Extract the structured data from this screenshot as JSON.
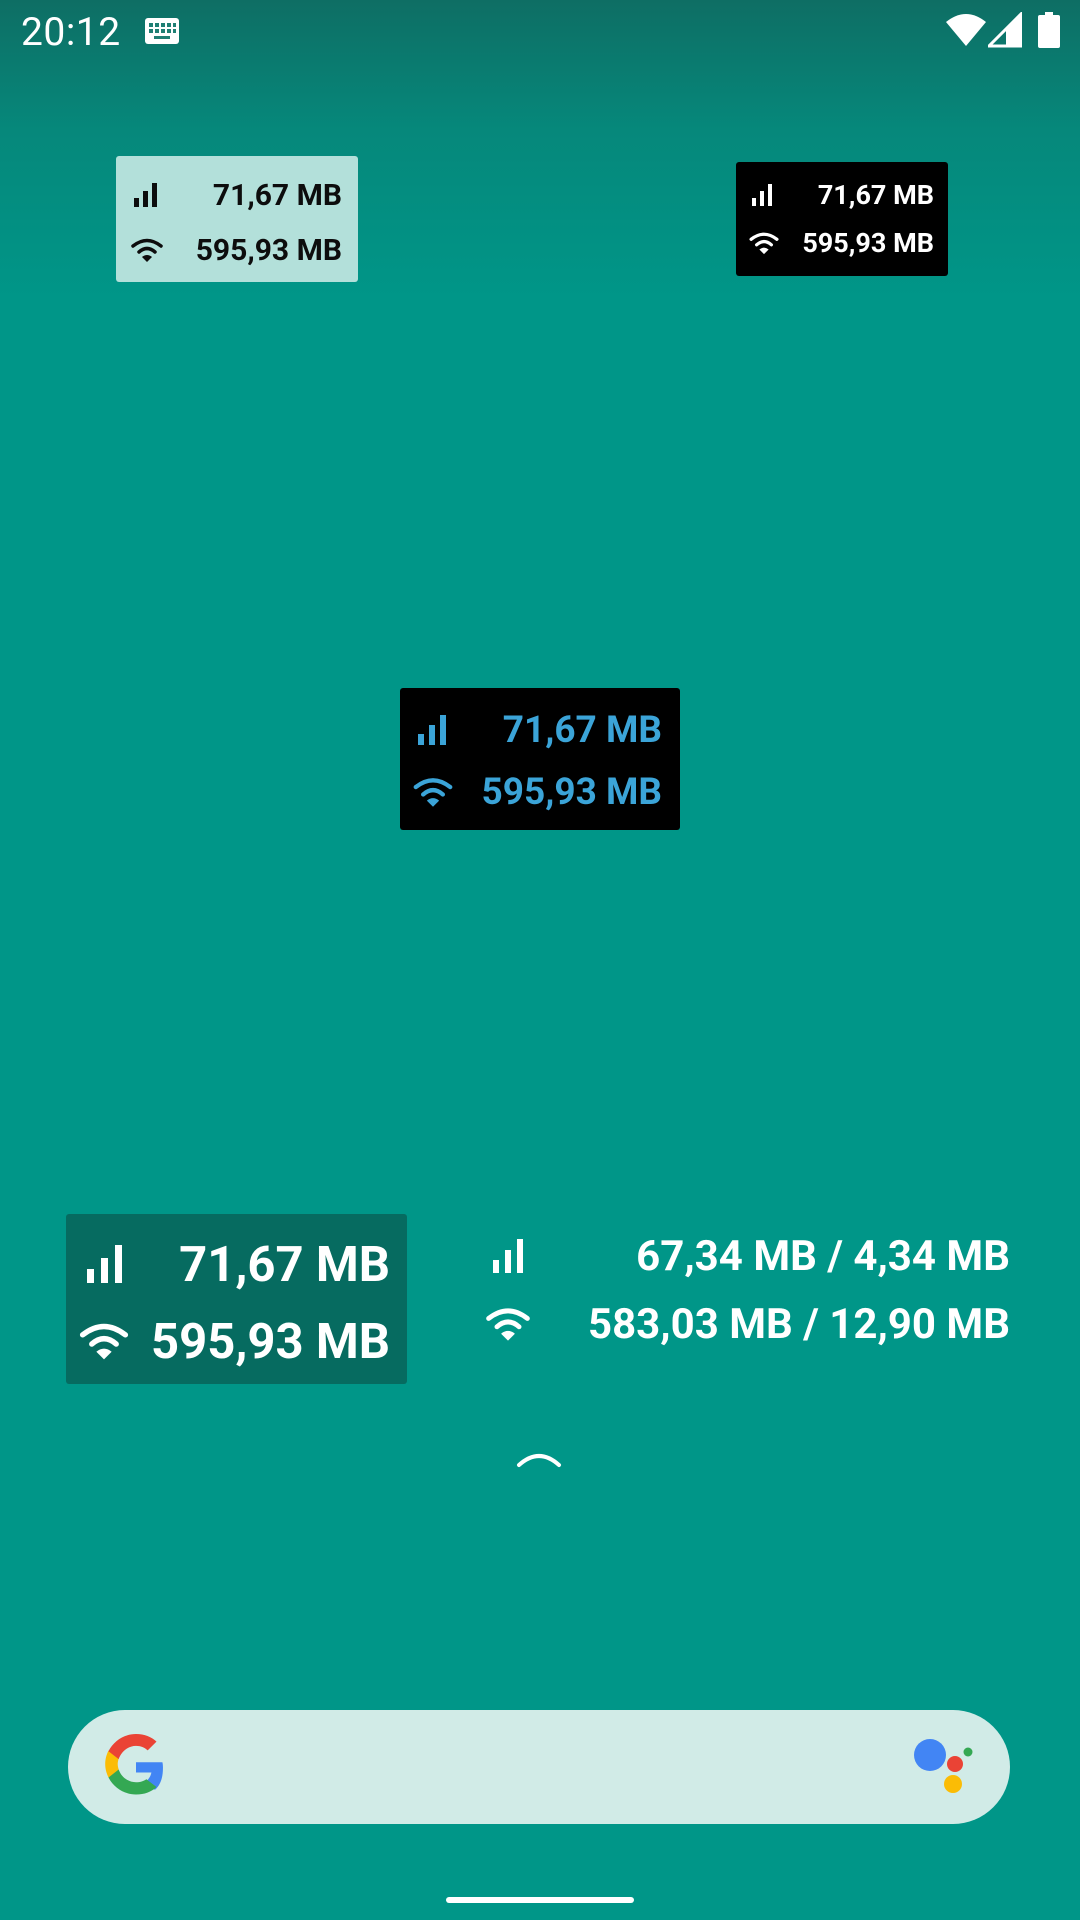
{
  "status_bar": {
    "time": "20:12",
    "icons": [
      "keyboard-icon",
      "wifi-icon",
      "cell-signal-icon",
      "battery-icon"
    ]
  },
  "widgets": [
    {
      "style": "light",
      "background": "#b3e0da",
      "text_color": "#0d0d0d",
      "mobile": "71,67 MB",
      "wifi": "595,93 MB"
    },
    {
      "style": "dark",
      "background": "#000000",
      "text_color": "#ffffff",
      "mobile": "71,67 MB",
      "wifi": "595,93 MB"
    },
    {
      "style": "dark-blue",
      "background": "#000000",
      "text_color": "#3ba4d8",
      "mobile": "71,67 MB",
      "wifi": "595,93 MB"
    },
    {
      "style": "teal-dark-large",
      "background": "#066b60",
      "text_color": "#ffffff",
      "mobile": "71,67 MB",
      "wifi": "595,93 MB"
    },
    {
      "style": "transparent-detailed",
      "background": "transparent",
      "text_color": "#ffffff",
      "mobile": "67,34 MB / 4,34 MB",
      "wifi": "583,03 MB / 12,90 MB"
    }
  ],
  "search_bar": {
    "left_icon": "google-g-icon",
    "right_icon": "google-assistant-icon"
  },
  "colors": {
    "wallpaper": "#009688",
    "search_bar": "#d1ebe7"
  }
}
